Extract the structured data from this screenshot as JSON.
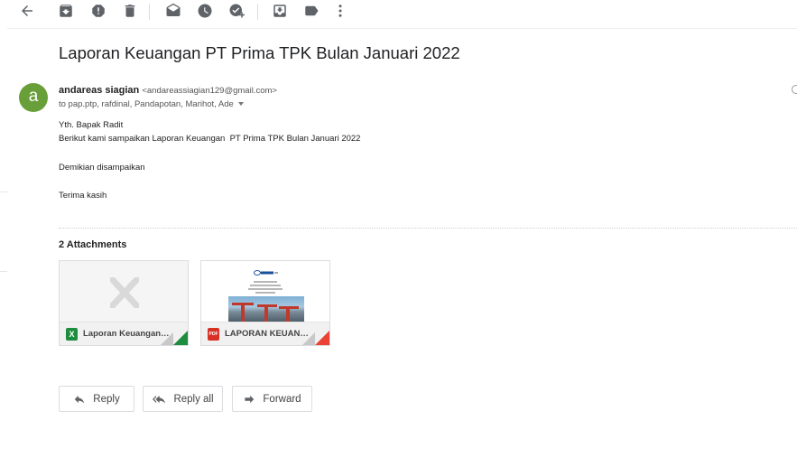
{
  "toolbar": {
    "icons": [
      "back-arrow-icon",
      "archive-icon",
      "report-spam-icon",
      "delete-icon",
      "mark-unread-icon",
      "snooze-icon",
      "add-to-tasks-icon",
      "move-to-icon",
      "label-icon",
      "more-icon"
    ]
  },
  "email": {
    "subject": "Laporan Keuangan PT Prima TPK Bulan Januari 2022",
    "avatar_letter": "a",
    "avatar_color": "#689f38",
    "sender_name": "andareas siagian",
    "sender_email": "<andareassiagian129@gmail.com>",
    "recipients": "to pap.ptp, rafdinal, Pandapotan, Marihot, Ade",
    "body": [
      "Yth. Bapak Radit",
      "Berikut kami sampaikan Laporan Keuangan  PT Prima TPK Bulan Januari 2022",
      "Demikian disampaikan",
      "Terima kasih"
    ]
  },
  "attachments": {
    "heading": "2 Attachments",
    "items": [
      {
        "name": "Laporan Keuangan ...",
        "badge": "X",
        "badge_color": "#1e8e3e",
        "corner_color": "#1e8e3e",
        "type": "xlsx"
      },
      {
        "name": "LAPORAN KEUANG...",
        "badge": "PDF",
        "badge_color": "#d93025",
        "corner_color": "#ea4335",
        "type": "pdf"
      }
    ]
  },
  "actions": {
    "reply": "Reply",
    "reply_all": "Reply all",
    "forward": "Forward"
  }
}
